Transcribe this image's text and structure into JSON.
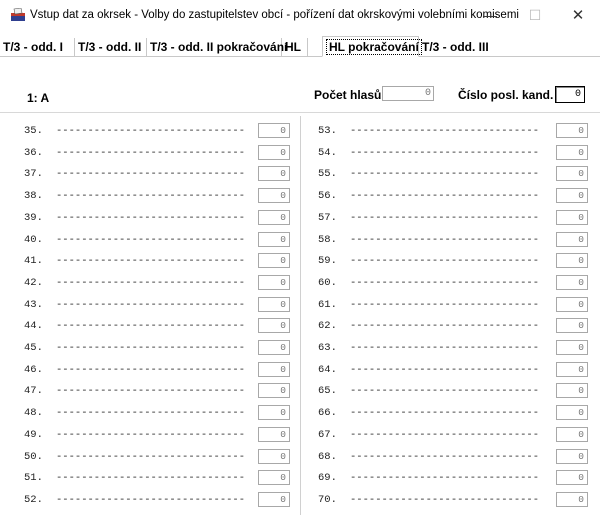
{
  "window": {
    "title": "Vstup dat za okrsek - Volby do zastupitelstev obcí - pořízení dat okrskovými volebními komisemi",
    "minimize_glyph": "—",
    "maximize_glyph": "☐",
    "close_glyph": "✕",
    "icon": "ballot-box-icon"
  },
  "tabs": [
    {
      "label": "T/3 - odd. I",
      "active": false
    },
    {
      "label": "T/3 - odd. II",
      "active": false
    },
    {
      "label": "T/3 - odd. II pokračování",
      "active": false
    },
    {
      "label": "HL",
      "active": false
    },
    {
      "label": "HL pokračování",
      "active": true
    },
    {
      "label": "T/3 - odd. III",
      "active": false
    }
  ],
  "header": {
    "candidate": "1: A",
    "votes_label": "Počet hlasů",
    "votes_value": "0",
    "cand_number_label": "Číslo posl. kand.",
    "cand_number_value": "0"
  },
  "left_rows": [
    {
      "num": "35.",
      "value": "0"
    },
    {
      "num": "36.",
      "value": "0"
    },
    {
      "num": "37.",
      "value": "0"
    },
    {
      "num": "38.",
      "value": "0"
    },
    {
      "num": "39.",
      "value": "0"
    },
    {
      "num": "40.",
      "value": "0"
    },
    {
      "num": "41.",
      "value": "0"
    },
    {
      "num": "42.",
      "value": "0"
    },
    {
      "num": "43.",
      "value": "0"
    },
    {
      "num": "44.",
      "value": "0"
    },
    {
      "num": "45.",
      "value": "0"
    },
    {
      "num": "46.",
      "value": "0"
    },
    {
      "num": "47.",
      "value": "0"
    },
    {
      "num": "48.",
      "value": "0"
    },
    {
      "num": "49.",
      "value": "0"
    },
    {
      "num": "50.",
      "value": "0"
    },
    {
      "num": "51.",
      "value": "0"
    },
    {
      "num": "52.",
      "value": "0"
    }
  ],
  "right_rows": [
    {
      "num": "53.",
      "value": "0"
    },
    {
      "num": "54.",
      "value": "0"
    },
    {
      "num": "55.",
      "value": "0"
    },
    {
      "num": "56.",
      "value": "0"
    },
    {
      "num": "57.",
      "value": "0"
    },
    {
      "num": "58.",
      "value": "0"
    },
    {
      "num": "59.",
      "value": "0"
    },
    {
      "num": "60.",
      "value": "0"
    },
    {
      "num": "61.",
      "value": "0"
    },
    {
      "num": "62.",
      "value": "0"
    },
    {
      "num": "63.",
      "value": "0"
    },
    {
      "num": "64.",
      "value": "0"
    },
    {
      "num": "65.",
      "value": "0"
    },
    {
      "num": "66.",
      "value": "0"
    },
    {
      "num": "67.",
      "value": "0"
    },
    {
      "num": "68.",
      "value": "0"
    },
    {
      "num": "69.",
      "value": "0"
    },
    {
      "num": "70.",
      "value": "0"
    }
  ],
  "name_placeholder": "------------------------------"
}
